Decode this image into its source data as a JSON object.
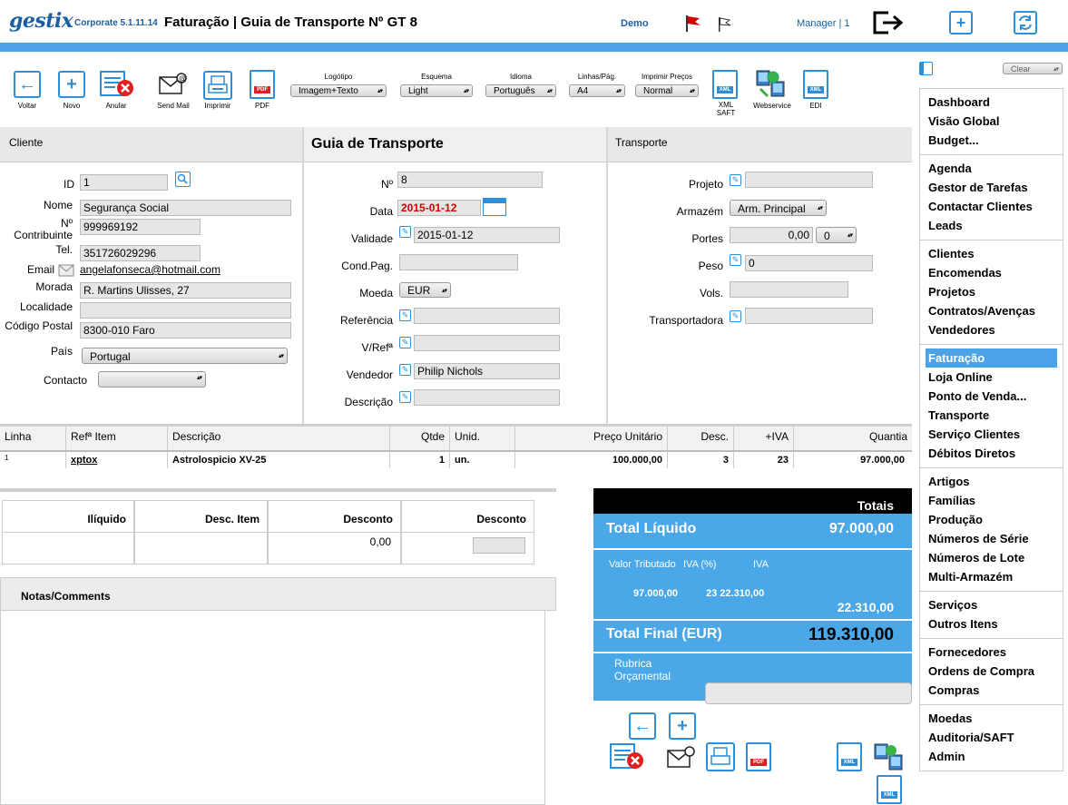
{
  "header": {
    "logo": "gestix",
    "version": "Corporate 5.1.11.14",
    "title": "Faturação | Guia de Transporte Nº GT 8",
    "demo": "Demo",
    "manager": "Manager | 1"
  },
  "toolbar": {
    "voltar": "Voltar",
    "novo": "Novo",
    "anular": "Anular",
    "send_mail": "Send Mail",
    "imprimir": "Imprimir",
    "pdf": "PDF",
    "logotipo_label": "Logótipo",
    "logotipo_value": "Imagem+Texto",
    "esquema_label": "Esquema",
    "esquema_value": "Light",
    "idioma_label": "Idioma",
    "idioma_value": "Português",
    "linhas_label": "Linhas/Pág.",
    "linhas_value": "A4",
    "imprimir_precos_label": "Imprimir Preços",
    "imprimir_precos_value": "Normal",
    "xml_saft": "XML SAFT",
    "webservice": "Webservice",
    "edi": "EDI",
    "pdf_tag": "PDF",
    "xml_tag": "XML"
  },
  "cliente": {
    "heading": "Cliente",
    "id_label": "ID",
    "id_value": "1",
    "nome_label": "Nome",
    "nome_value": "Segurança Social",
    "contribuinte_label": "Nº Contribuinte",
    "contribuinte_value": "999969192",
    "tel_label": "Tel.",
    "tel_value": "351726029296",
    "email_label": "Email",
    "email_value": "angelafonseca@hotmail.com",
    "morada_label": "Morada",
    "morada_value": "R. Martins Ulisses, 27",
    "localidade_label": "Localidade",
    "localidade_value": "",
    "codigo_postal_label": "Código Postal",
    "codigo_postal_value": "8300-010 Faro",
    "pais_label": "País",
    "pais_value": "Portugal",
    "contacto_label": "Contacto",
    "contacto_value": ""
  },
  "guia": {
    "heading": "Guia de Transporte",
    "n_label": "Nº",
    "n_value": "8",
    "data_label": "Data",
    "data_value": "2015-01-12",
    "validade_label": "Validade",
    "validade_value": "2015-01-12",
    "condpag_label": "Cond.Pag.",
    "condpag_value": "",
    "moeda_label": "Moeda",
    "moeda_value": "EUR",
    "referencia_label": "Referência",
    "referencia_value": "",
    "vref_label": "V/Refª",
    "vref_value": "",
    "vendedor_label": "Vendedor",
    "vendedor_value": "Philip Nichols",
    "descricao_label": "Descrição",
    "descricao_value": ""
  },
  "transporte": {
    "heading": "Transporte",
    "projeto_label": "Projeto",
    "projeto_value": "",
    "armazem_label": "Armazém",
    "armazem_value": "Arm. Principal",
    "portes_label": "Portes",
    "portes_value": "0,00",
    "portes_select": "0",
    "peso_label": "Peso",
    "peso_value": "0",
    "vols_label": "Vols.",
    "vols_value": "",
    "transportadora_label": "Transportadora",
    "transportadora_value": ""
  },
  "lines_table": {
    "headers": [
      "Linha",
      "Refª Item",
      "Descrição",
      "Qtde",
      "Unid.",
      "Preço Unitário",
      "Desc.",
      "+IVA",
      "Quantia"
    ],
    "rows": [
      {
        "linha": "1",
        "ref": "xptox",
        "descricao": "Astrolospicio XV-25",
        "qtde": "1",
        "unid": "un.",
        "preco": "100.000,00",
        "desc": "3",
        "iva": "23",
        "quantia": "97.000,00"
      }
    ]
  },
  "summary_table": {
    "headers": [
      "Ilíquido",
      "Desc. Item",
      "Desconto",
      "Desconto"
    ],
    "desconto_value": "0,00"
  },
  "notas": {
    "heading": "Notas/Comments"
  },
  "totals": {
    "heading": "Totais",
    "liquido_label": "Total Líquido",
    "liquido_value": "97.000,00",
    "valor_tributado_label": "Valor Tributado",
    "iva_pct_label": "IVA (%)",
    "iva_label": "IVA",
    "vt_value": "97.000,00",
    "iva_row": "23 22.310,00",
    "iva_total": "22.310,00",
    "final_label": "Total Final (EUR)",
    "final_value": "119.310,00",
    "rubrica_label": "Rubrica Orçamental"
  },
  "sidebar": {
    "clear": "Clear",
    "groups": [
      [
        "Dashboard",
        "Visão Global",
        "Budget..."
      ],
      [
        "Agenda",
        "Gestor de Tarefas",
        "Contactar Clientes",
        "Leads"
      ],
      [
        "Clientes",
        "Encomendas",
        "Projetos",
        "Contratos/Avenças",
        "Vendedores"
      ],
      [
        "Faturação",
        "Loja Online",
        "Ponto de Venda...",
        "Transporte",
        "Serviço Clientes",
        "Débitos Diretos"
      ],
      [
        "Artigos",
        "Famílias",
        "Produção",
        "Números de Série",
        "Números de Lote",
        "Multi-Armazém"
      ],
      [
        "Serviços",
        "Outros Itens"
      ],
      [
        "Fornecedores",
        "Ordens de Compra",
        "Compras"
      ],
      [
        "Moedas",
        "Auditoria/SAFT",
        "Admin"
      ]
    ],
    "active": "Faturação"
  },
  "colors": {
    "accent": "#49a3e6",
    "brand": "#1b5fa0",
    "totals_bg": "#4aa8e8",
    "date_red": "#d40000"
  }
}
